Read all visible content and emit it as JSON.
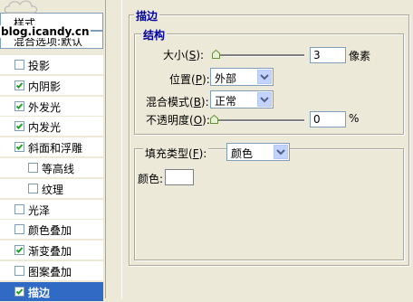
{
  "sidebar": {
    "header_styles": "样式",
    "header_blending": "混合选项:默认",
    "watermark": "blog.icandy.cn",
    "items": [
      {
        "label": "投影",
        "checked": false,
        "indent": false,
        "selected": false
      },
      {
        "label": "内阴影",
        "checked": true,
        "indent": false,
        "selected": false
      },
      {
        "label": "外发光",
        "checked": true,
        "indent": false,
        "selected": false
      },
      {
        "label": "内发光",
        "checked": true,
        "indent": false,
        "selected": false
      },
      {
        "label": "斜面和浮雕",
        "checked": true,
        "indent": false,
        "selected": false
      },
      {
        "label": "等高线",
        "checked": false,
        "indent": true,
        "selected": false
      },
      {
        "label": "纹理",
        "checked": false,
        "indent": true,
        "selected": false
      },
      {
        "label": "光泽",
        "checked": false,
        "indent": false,
        "selected": false
      },
      {
        "label": "颜色叠加",
        "checked": false,
        "indent": false,
        "selected": false
      },
      {
        "label": "渐变叠加",
        "checked": true,
        "indent": false,
        "selected": false
      },
      {
        "label": "图案叠加",
        "checked": false,
        "indent": false,
        "selected": false
      },
      {
        "label": "描边",
        "checked": true,
        "indent": false,
        "selected": true
      }
    ]
  },
  "stroke": {
    "title": "描边",
    "structure_title": "结构",
    "size_label": "大小(",
    "size_key": "S",
    "size_tail": "):",
    "size_value": "3",
    "size_unit": "像素",
    "size_slider_fraction": 0.02,
    "position_label": "位置(",
    "position_key": "P",
    "position_tail": "):",
    "position_value": "外部",
    "blend_label": "混合模式(",
    "blend_key": "B",
    "blend_tail": "):",
    "blend_value": "正常",
    "opacity_label": "不透明度(",
    "opacity_key": "O",
    "opacity_tail": "):",
    "opacity_value": "0",
    "opacity_unit": "%",
    "opacity_slider_fraction": 0.0,
    "fill_type_label": "填充类型(",
    "fill_type_key": "F",
    "fill_type_tail": "):",
    "fill_type_value": "颜色",
    "color_label": "颜色:",
    "color_value": "#ffffff"
  },
  "colors": {
    "selection": "#316ac5",
    "group_title": "#00009c",
    "check": "#21a121"
  }
}
